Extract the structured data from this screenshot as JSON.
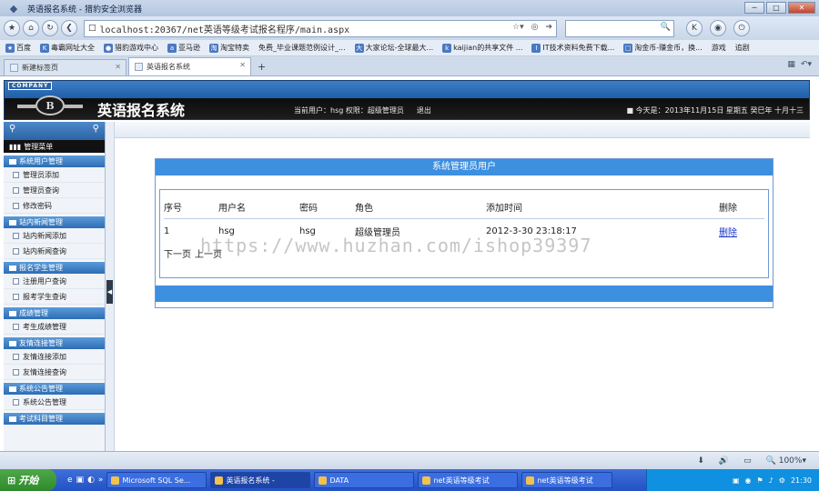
{
  "browser": {
    "window_title": "英语报名系统 - 猎豹安全浏览器",
    "url": "localhost:20367/net英语等级考试报名程序/main.aspx",
    "favorites": [
      "百度",
      "毒霸网址大全",
      "猎豹游戏中心",
      "亚马逊",
      "淘宝特卖",
      "免费_毕业课题范例设计_...",
      "大家论坛-全球最大...",
      "kaijian的共享文件 ...",
      "IT技术资料免费下载...",
      "淘金币-赚金币，换..."
    ],
    "favorites_right": [
      "游戏",
      "追剧"
    ],
    "tabs": [
      {
        "label": "新建标签页",
        "active": false
      },
      {
        "label": "英语报名系统",
        "active": true
      }
    ],
    "zoom": "100%"
  },
  "app": {
    "company_badge": "COMPANY",
    "emblem_letter": "B",
    "name": "英语报名系统",
    "current_user_label": "当前用户：hsg",
    "permission_label": "权限：超级管理员",
    "logout_label": "退出",
    "date_text": "今天是：2013年11月15日 星期五 癸巳年 十月十三"
  },
  "sidebar": {
    "menu_title": "管理菜单",
    "groups": [
      {
        "title": "系统用户管理",
        "items": [
          "管理员添加",
          "管理员查询",
          "修改密码"
        ]
      },
      {
        "title": "站内新闻管理",
        "items": [
          "站内新闻添加",
          "站内新闻查询"
        ]
      },
      {
        "title": "报名学生管理",
        "items": [
          "注册用户查询",
          "报考学生查询"
        ]
      },
      {
        "title": "成绩管理",
        "items": [
          "考生成绩管理"
        ]
      },
      {
        "title": "友情连接管理",
        "items": [
          "友情连接添加",
          "友情连接查询"
        ]
      },
      {
        "title": "系统公告管理",
        "items": [
          "系统公告管理"
        ]
      },
      {
        "title": "考试科目管理",
        "items": []
      }
    ]
  },
  "panel": {
    "title": "系统管理员用户",
    "headers": [
      "序号",
      "用户名",
      "密码",
      "角色",
      "添加时间",
      "删除"
    ],
    "rows": [
      {
        "id": "1",
        "username": "hsg",
        "password": "hsg",
        "role": "超级管理员",
        "added": "2012-3-30 23:18:17",
        "delete": "删除"
      }
    ],
    "next_page": "下一页",
    "prev_page": "上一页"
  },
  "watermark": "https://www.huzhan.com/ishop39397",
  "taskbar": {
    "start": "开始",
    "items": [
      "Microsoft SQL Se...",
      "英语报名系统 -",
      "DATA",
      "net英语等级考试",
      "net英语等级考试"
    ],
    "active_index": 1,
    "clock": "21:30"
  }
}
